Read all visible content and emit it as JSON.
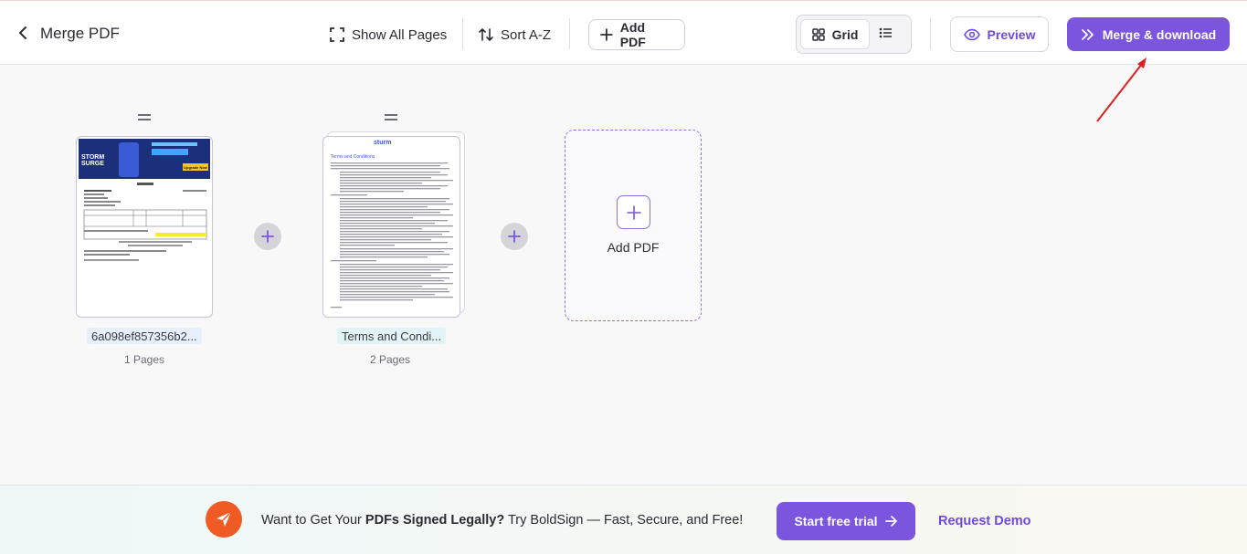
{
  "header": {
    "title": "Merge PDF",
    "show_all_pages": "Show All Pages",
    "sort": "Sort A-Z",
    "add_pdf": "Add PDF",
    "view_grid": "Grid",
    "preview": "Preview",
    "merge_download": "Merge & download"
  },
  "files": [
    {
      "name": "6a098ef857356b2...",
      "pages": "1 Pages",
      "thumb_banner_line1": "STORM",
      "thumb_banner_line2": "SURGE",
      "thumb_cta": "Upgrade Now"
    },
    {
      "name": "Terms and Condi...",
      "pages": "2 Pages",
      "thumb_title": "Terms and Conditions"
    }
  ],
  "add_zone": {
    "label": "Add PDF"
  },
  "footer": {
    "promo_pre": "Want to Get Your ",
    "promo_bold": "PDFs Signed Legally?",
    "promo_post": " Try BoldSign — Fast, Secure, and Free!",
    "trial_button": "Start free trial",
    "demo_link": "Request Demo"
  },
  "colors": {
    "accent": "#7b55dd",
    "annotation_arrow": "#e02020",
    "boldsign_brand": "#f05a24"
  }
}
